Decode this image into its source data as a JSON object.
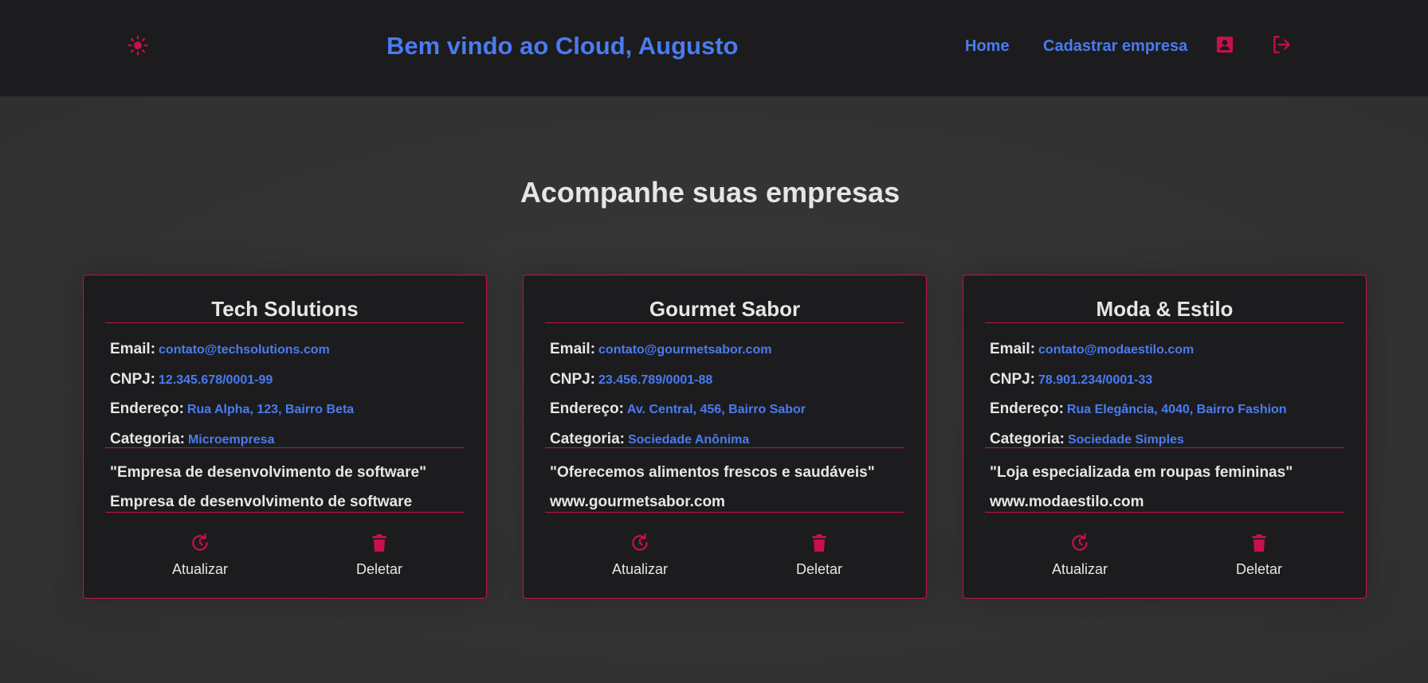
{
  "header": {
    "welcome": "Bem vindo ao Cloud, Augusto",
    "nav": {
      "home": "Home",
      "cadastrar": "Cadastrar empresa"
    },
    "icons": [
      "sun-icon",
      "profile-icon",
      "logout-icon"
    ]
  },
  "main": {
    "heading": "Acompanhe suas empresas"
  },
  "labels": {
    "email": "Email:",
    "cnpj": "CNPJ:",
    "endereco": "Endereço:",
    "categoria": "Categoria:",
    "atualizar": "Atualizar",
    "deletar": "Deletar"
  },
  "companies": [
    {
      "name": "Tech Solutions",
      "email": "contato@techsolutions.com",
      "cnpj": "12.345.678/0001-99",
      "endereco": "Rua Alpha, 123, Bairro Beta",
      "categoria": "Microempresa",
      "descricao": "\"Empresa de desenvolvimento de software\"",
      "site": "Empresa de desenvolvimento de software"
    },
    {
      "name": "Gourmet Sabor",
      "email": "contato@gourmetsabor.com",
      "cnpj": "23.456.789/0001-88",
      "endereco": "Av. Central, 456, Bairro Sabor",
      "categoria": "Sociedade Anônima",
      "descricao": "\"Oferecemos alimentos frescos e saudáveis\"",
      "site": "www.gourmetsabor.com"
    },
    {
      "name": "Moda & Estilo",
      "email": "contato@modaestilo.com",
      "cnpj": "78.901.234/0001-33",
      "endereco": "Rua Elegância, 4040, Bairro Fashion",
      "categoria": "Sociedade Simples",
      "descricao": "\"Loja especializada em roupas femininas\"",
      "site": "www.modaestilo.com"
    }
  ],
  "colors": {
    "accent": "#c8104a",
    "link": "#4a7bf0",
    "header_bg": "#1c1c1e",
    "card_bg": "#1c1c1f",
    "page_bg": "#333333",
    "text": "#e6e6e6"
  }
}
